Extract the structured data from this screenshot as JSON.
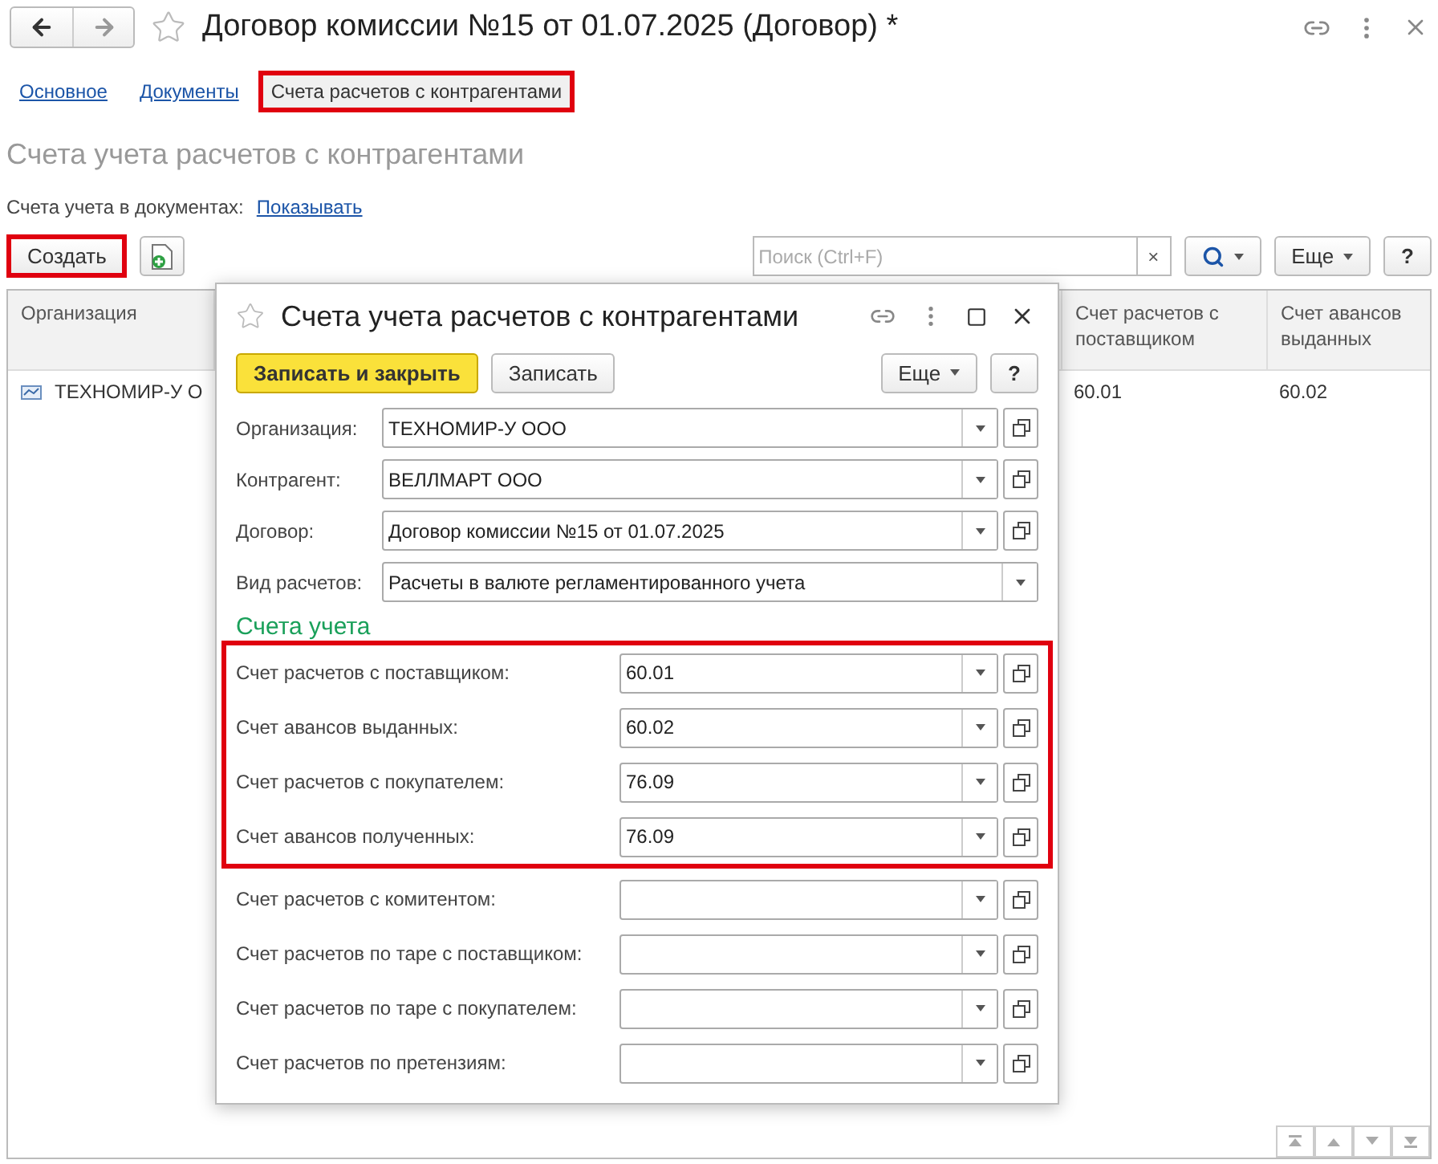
{
  "window": {
    "title": "Договор комиссии №15 от 01.07.2025 (Договор) *"
  },
  "tabs": [
    {
      "label": "Основное",
      "selected": false,
      "highlighted": false
    },
    {
      "label": "Документы",
      "selected": false,
      "highlighted": false
    },
    {
      "label": "Счета расчетов с контрагентами",
      "selected": true,
      "highlighted": true
    }
  ],
  "section_title": "Счета учета расчетов с контрагентами",
  "documents_accounts": {
    "label": "Счета учета в документах:",
    "link": "Показывать"
  },
  "toolbar": {
    "create_button": {
      "label": "Создать",
      "highlighted": true
    },
    "search": {
      "placeholder": "Поиск (Ctrl+F)",
      "clear": "×"
    },
    "more_button": "Еще",
    "help_button": "?"
  },
  "table": {
    "columns": [
      "Организация",
      "Счет расчетов с поставщиком",
      "Счет авансов выданных"
    ],
    "rows": [
      {
        "cells": [
          "ТЕХНОМИР-У О",
          "60.01",
          "60.02"
        ]
      }
    ]
  },
  "dialog": {
    "title": "Счета учета расчетов с контрагентами",
    "save_close_button": "Записать и закрыть",
    "save_button": "Записать",
    "more_button": "Еще",
    "help_button": "?",
    "fields": [
      {
        "label": "Организация:",
        "value": "ТЕХНОМИР-У ООО",
        "open_button": true
      },
      {
        "label": "Контрагент:",
        "value": "ВЕЛЛМАРТ ООО",
        "open_button": true
      },
      {
        "label": "Договор:",
        "value": "Договор комиссии №15 от 01.07.2025",
        "open_button": true
      },
      {
        "label": "Вид расчетов:",
        "value": "Расчеты в валюте регламентированного учета",
        "open_button": false
      }
    ],
    "accounts_title": "Счета учета",
    "highlighted_accounts": [
      {
        "label": "Счет расчетов с поставщиком:",
        "value": "60.01"
      },
      {
        "label": "Счет авансов выданных:",
        "value": "60.02"
      },
      {
        "label": "Счет расчетов с покупателем:",
        "value": "76.09"
      },
      {
        "label": "Счет авансов полученных:",
        "value": "76.09"
      }
    ],
    "other_accounts": [
      {
        "label": "Счет расчетов с комитентом:"
      },
      {
        "label": "Счет расчетов по таре с поставщиком:"
      },
      {
        "label": "Счет расчетов по таре с покупателем:"
      },
      {
        "label": "Счет расчетов по претензиям:"
      }
    ]
  }
}
